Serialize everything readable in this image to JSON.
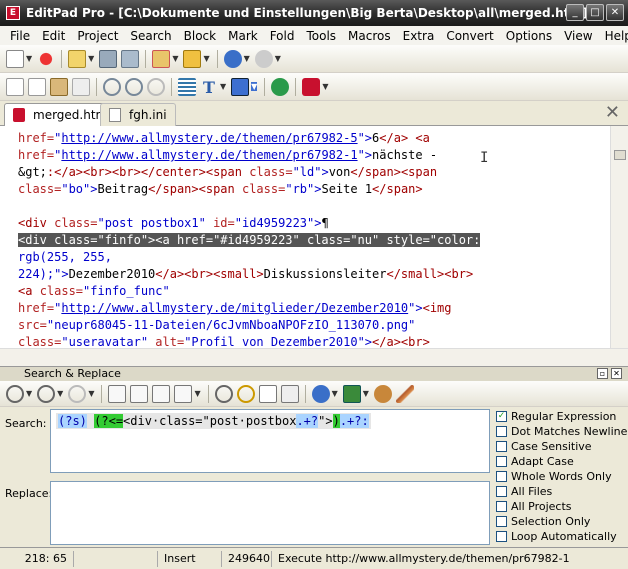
{
  "window": {
    "title": "EditPad Pro - [C:\\Dokumente und Einstellungen\\Big Berta\\Desktop\\all\\merged.htm]",
    "icon_text": "E"
  },
  "menu": [
    "File",
    "Edit",
    "Project",
    "Search",
    "Block",
    "Mark",
    "Fold",
    "Tools",
    "Macros",
    "Extra",
    "Convert",
    "Options",
    "View",
    "Help"
  ],
  "toolbar1": [
    "new-file-icon",
    "close-file-icon",
    "open-file-icon",
    "save-icon",
    "save-all-icon",
    "project-icon",
    "folder-icon",
    "undo-icon",
    "redo-icon"
  ],
  "toolbar2": [
    "copy-icon",
    "copy-alt-icon",
    "paste-icon",
    "cut-icon",
    "find-icon",
    "find-next-icon",
    "find-prev-icon",
    "indent-icon",
    "font-icon",
    "wrap-icon",
    "run-icon",
    "editpad-icon"
  ],
  "tabs": [
    {
      "label": "merged.htm",
      "active": true
    },
    {
      "label": "fgh.ini",
      "active": false
    }
  ],
  "editor_lines": [
    [
      [
        "a",
        "href="
      ],
      [
        "v",
        "\""
      ],
      [
        "u",
        "http://www.allmystery.de/themen/pr67982-5"
      ],
      [
        "v",
        "\">"
      ],
      [
        "k",
        "6"
      ],
      [
        "t",
        "</a>"
      ],
      [
        "k",
        " "
      ],
      [
        "t",
        "<a"
      ]
    ],
    [
      [
        "a",
        "href="
      ],
      [
        "v",
        "\""
      ],
      [
        "u",
        "http://www.allmystery.de/themen/pr67982-1"
      ],
      [
        "v",
        "\">"
      ],
      [
        "k",
        "nächste -"
      ]
    ],
    [
      [
        "k",
        "&gt;"
      ],
      [
        "t",
        ":</a><br><br></center><span "
      ],
      [
        "a",
        "class="
      ],
      [
        "v",
        "\"ld\">"
      ],
      [
        "k",
        "von"
      ],
      [
        "t",
        "</span><span"
      ]
    ],
    [
      [
        "a",
        "class="
      ],
      [
        "v",
        "\"bo\">"
      ],
      [
        "k",
        "Beitrag"
      ],
      [
        "t",
        "</span><span "
      ],
      [
        "a",
        "class="
      ],
      [
        "v",
        "\"rb\">"
      ],
      [
        "k",
        "Seite 1"
      ],
      [
        "t",
        "</span>"
      ]
    ],
    [],
    [
      [
        "t",
        "<div "
      ],
      [
        "a",
        "class="
      ],
      [
        "v",
        "\"post postbox1\" "
      ],
      [
        "a",
        "id="
      ],
      [
        "v",
        "\"id4959223\">"
      ],
      [
        "k",
        "¶"
      ]
    ],
    [
      [
        "sel",
        "<div class=\"finfo\"><a href=\"#id4959223\" class=\"nu\" style=\"color:"
      ]
    ],
    [
      [
        "v",
        "rgb(255, 255,"
      ]
    ],
    [
      [
        "v",
        "224);\">"
      ],
      [
        "k",
        "Dezember2010"
      ],
      [
        "t",
        "</a><br><small>"
      ],
      [
        "k",
        "Diskussionsleiter"
      ],
      [
        "t",
        "</small><br>"
      ]
    ],
    [
      [
        "t",
        "<a "
      ],
      [
        "a",
        "class="
      ],
      [
        "v",
        "\"finfo_func\""
      ]
    ],
    [
      [
        "a",
        "href="
      ],
      [
        "v",
        "\""
      ],
      [
        "u",
        "http://www.allmystery.de/mitglieder/Dezember2010"
      ],
      [
        "v",
        "\">"
      ],
      [
        "t",
        "<img"
      ]
    ],
    [
      [
        "a",
        "src="
      ],
      [
        "v",
        "\"neupr68045-11-Dateien/6cJvmNboaNPOFzIO_113070.png\""
      ]
    ],
    [
      [
        "a",
        "class="
      ],
      [
        "v",
        "\"useravatar\" "
      ],
      [
        "a",
        "alt="
      ],
      [
        "v",
        "\"Profil von Dezember2010\">"
      ],
      [
        "t",
        "</a><br>"
      ]
    ]
  ],
  "search_panel": {
    "title": "Search & Replace",
    "search_label": "Search:",
    "replace_label": "Replace:",
    "search_parts": [
      [
        "rx1",
        "(?s)"
      ],
      [
        "k",
        " "
      ],
      [
        "rx2",
        "(?<="
      ],
      [
        "k",
        "<div·class=\"post·postbox"
      ],
      [
        "rx3",
        ".+?"
      ],
      [
        "k",
        "\">"
      ],
      [
        "rx2",
        ")"
      ],
      [
        "rx3",
        ".+?:"
      ]
    ],
    "replace_value": "",
    "options": [
      {
        "label": "Regular Expression",
        "checked": true
      },
      {
        "label": "Dot Matches Newline",
        "checked": false
      },
      {
        "label": "Case Sensitive",
        "checked": false
      },
      {
        "label": "Adapt Case",
        "checked": false
      },
      {
        "label": "Whole Words Only",
        "checked": false
      },
      {
        "label": "All Files",
        "checked": false
      },
      {
        "label": "All Projects",
        "checked": false
      },
      {
        "label": "Selection Only",
        "checked": false
      },
      {
        "label": "Loop Automatically",
        "checked": false
      }
    ]
  },
  "status": {
    "position": "218: 65",
    "blank": "",
    "mode": "Insert",
    "size": "249640",
    "message": "Execute http://www.allmystery.de/themen/pr67982-1"
  }
}
